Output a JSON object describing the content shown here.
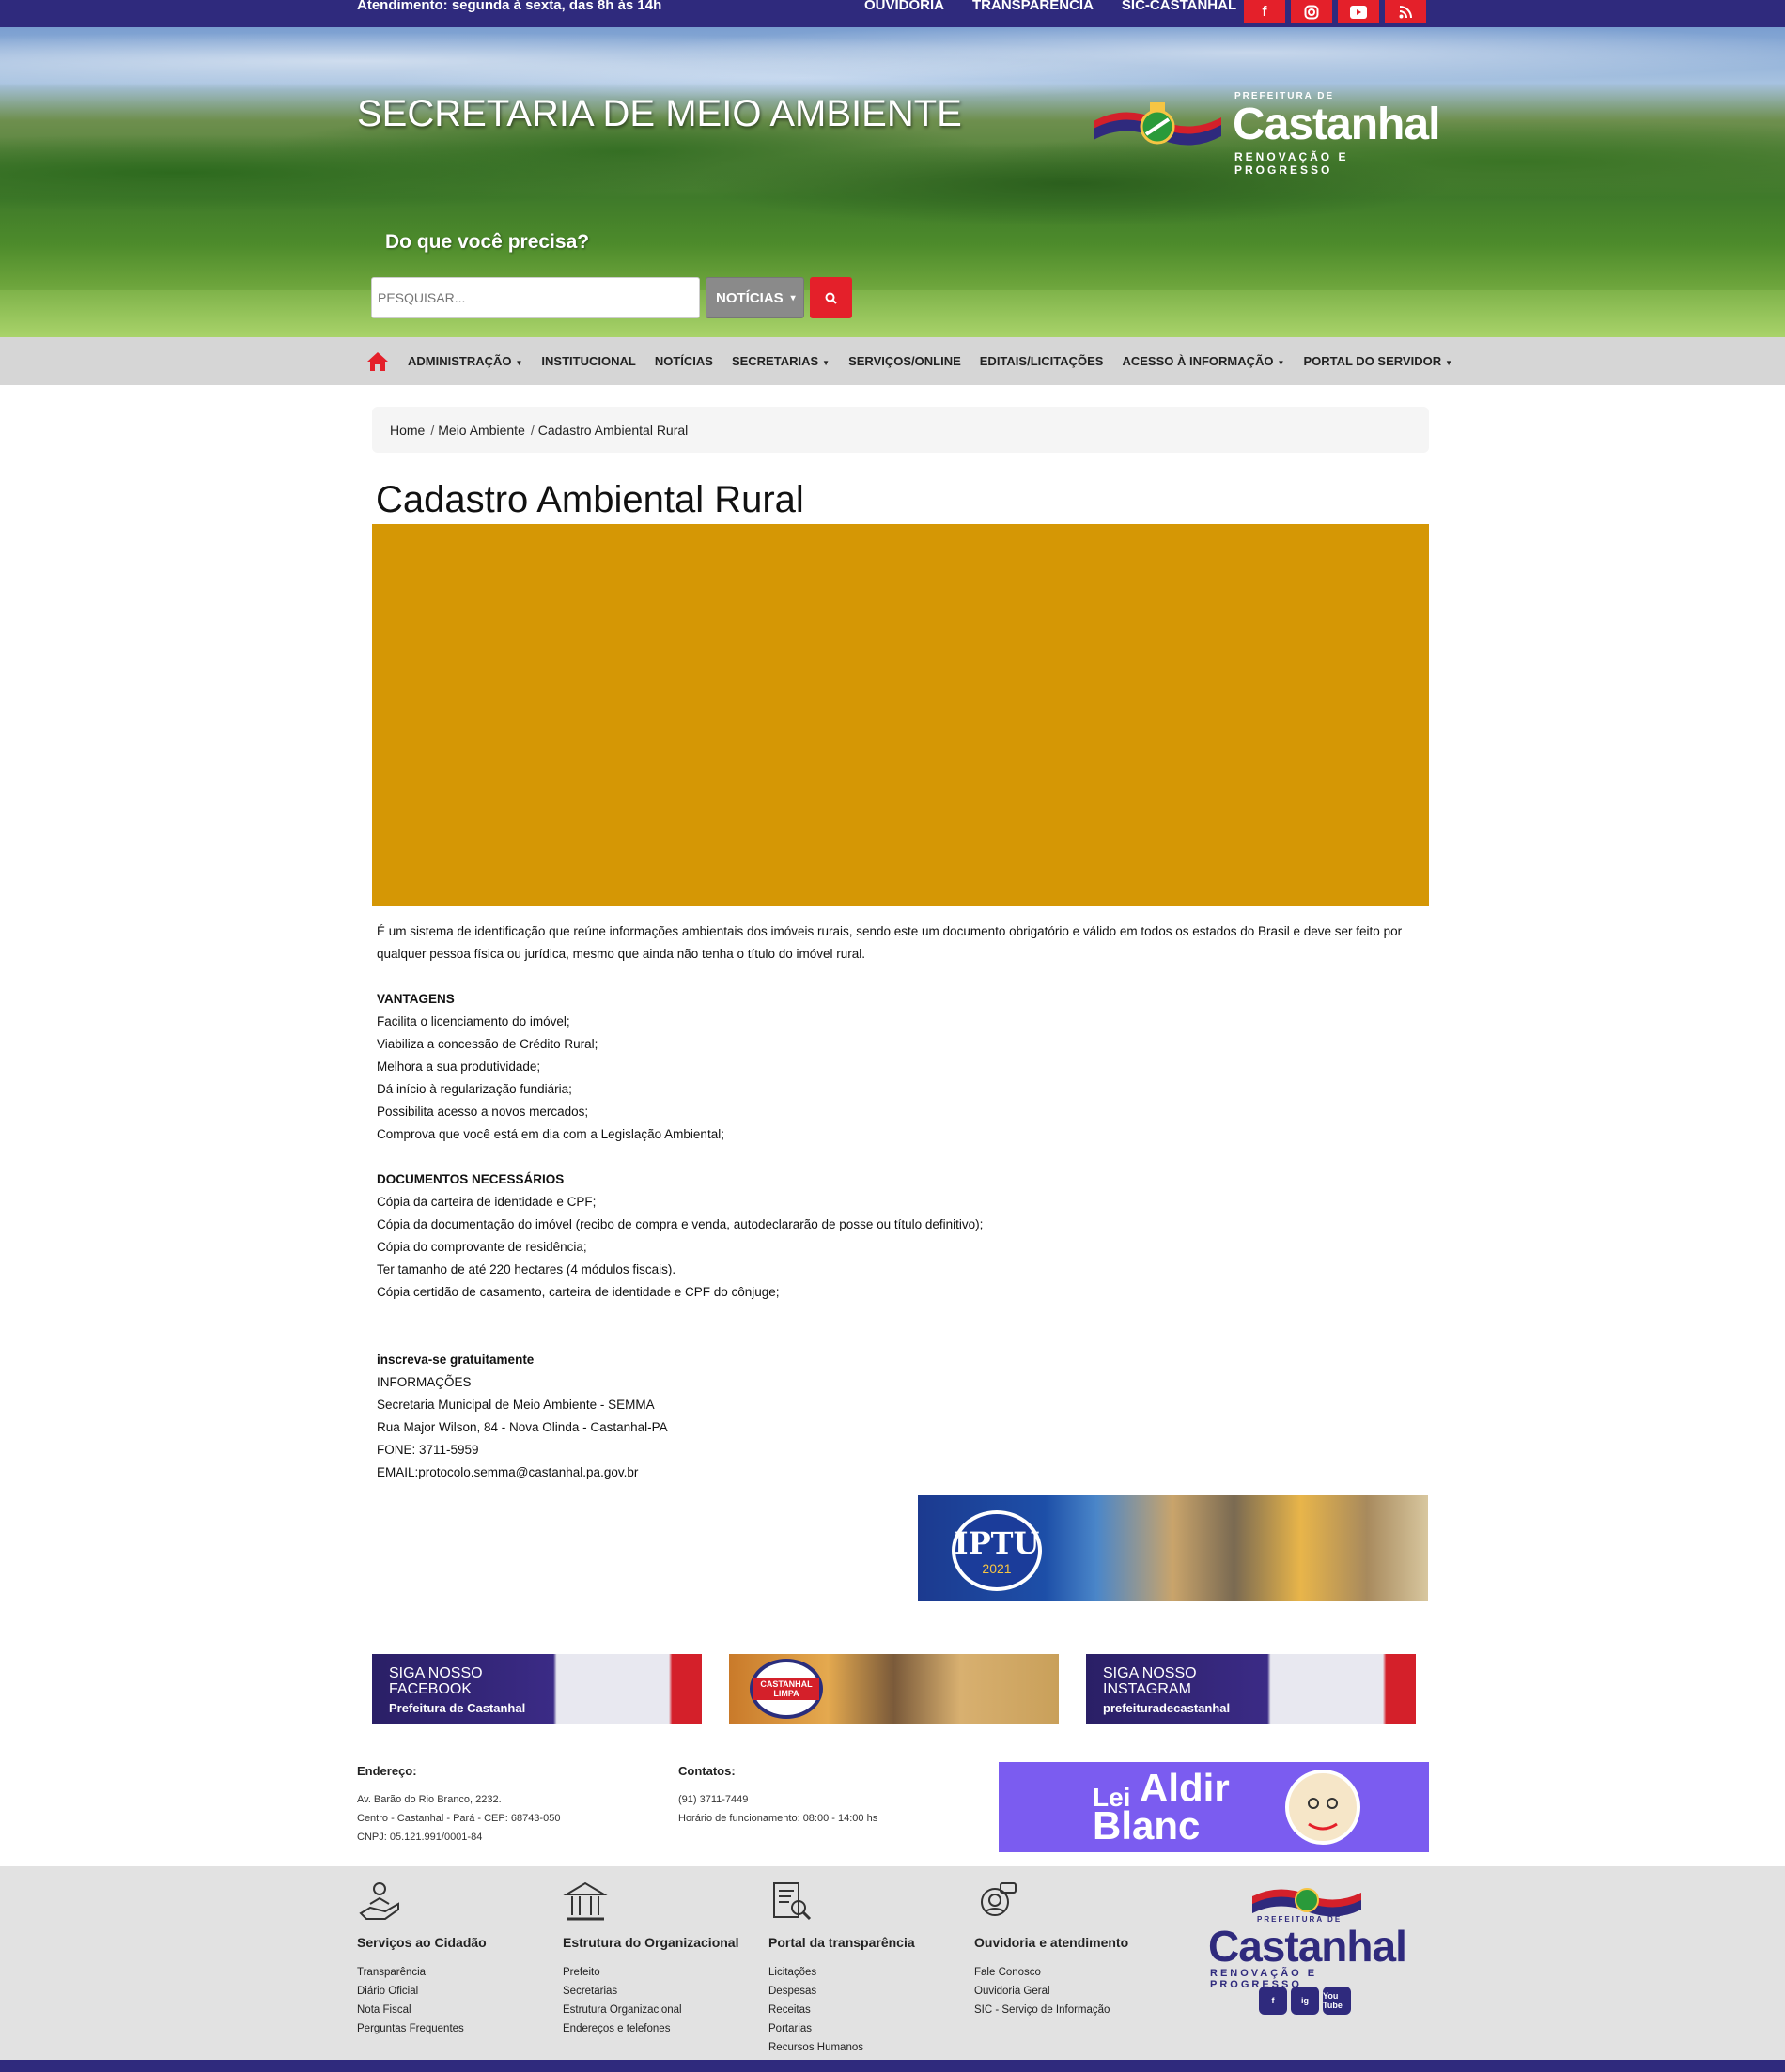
{
  "topbar": {
    "hours": "Atendimento: segunda à sexta, das 8h às 14h",
    "links": [
      "OUVIDORIA",
      "TRANSPARÊNCIA",
      "SIC-CASTANHAL"
    ],
    "social_icons": [
      "facebook-icon",
      "instagram-icon",
      "youtube-icon",
      "rss-icon"
    ],
    "accent": "#e4202a",
    "bg": "#2f2a7d"
  },
  "header": {
    "title": "SECRETARIA DE MEIO AMBIENTE",
    "logo": {
      "prefix": "PREFEITURA DE",
      "name": "Castanhal",
      "slogan": "RENOVAÇÃO E PROGRESSO"
    },
    "search_question": "Do que você precisa?",
    "search_placeholder": "PESQUISAR...",
    "search_category": "NOTÍCIAS"
  },
  "nav": {
    "items": [
      {
        "label": "ADMINISTRAÇÃO",
        "dropdown": true
      },
      {
        "label": "INSTITUCIONAL",
        "dropdown": false
      },
      {
        "label": "NOTÍCIAS",
        "dropdown": false
      },
      {
        "label": "SECRETARIAS",
        "dropdown": true
      },
      {
        "label": "SERVIÇOS/ONLINE",
        "dropdown": false
      },
      {
        "label": "EDITAIS/LICITAÇÕES",
        "dropdown": false
      },
      {
        "label": "ACESSO À INFORMAÇÃO",
        "dropdown": true
      },
      {
        "label": "PORTAL DO SERVIDOR",
        "dropdown": true
      }
    ]
  },
  "breadcrumb": {
    "home": "Home",
    "section": "Meio Ambiente",
    "current": "Cadastro Ambiental Rural"
  },
  "page": {
    "title": "Cadastro Ambiental Rural",
    "intro": "É um sistema de identificação que reúne informações ambientais dos imóveis rurais, sendo este um documento obrigatório e válido em todos os estados do Brasil e deve ser feito por qualquer pessoa física ou jurídica, mesmo que ainda não tenha o título do imóvel rural.",
    "vantagens_title": "VANTAGENS",
    "vantagens": [
      "Facilita o licenciamento do imóvel;",
      "Viabiliza a concessão de Crédito Rural;",
      "Melhora a sua produtividade;",
      "Dá início à regularização fundiária;",
      "Possibilita acesso a novos mercados;",
      "Comprova que você está em dia com a Legislação Ambiental;"
    ],
    "documentos_title": "DOCUMENTOS NECESSÁRIOS",
    "documentos": [
      "Cópia da carteira de identidade e CPF;",
      "Cópia da documentação do imóvel (recibo de compra e venda, autodeclararão de posse ou título definitivo);",
      "Cópia do comprovante de residência;",
      "Ter tamanho de até 220 hectares (4 módulos fiscais).",
      "Cópia certidão de casamento, carteira de identidade e CPF do cônjuge;"
    ],
    "inscreva": "inscreva-se gratuitamente",
    "info": [
      "INFORMAÇÕES",
      "Secretaria Municipal de Meio Ambiente - SEMMA",
      "Rua Major Wilson, 84 - Nova Olinda - Castanhal-PA",
      "FONE: 3711-5959",
      "EMAIL:protocolo.semma@castanhal.pa.gov.br"
    ],
    "image_color": "#d59705"
  },
  "iptu_banner": {
    "title": "IPTU",
    "year": "2021"
  },
  "banners": {
    "facebook": {
      "line1": "SIGA NOSSO",
      "line2": "FACEBOOK",
      "account": "Prefeitura de Castanhal"
    },
    "limpa": {
      "label": "CASTANHAL LIMPA"
    },
    "instagram": {
      "line1": "SIGA NOSSO",
      "line2": "INSTAGRAM",
      "account": "prefeiturадecastanhal"
    }
  },
  "footer_info": {
    "address_title": "Endereço:",
    "address": [
      "Av. Barão do Rio Branco, 2232.",
      "Centro - Castanhal - Pará - CEP: 68743-050",
      "CNPJ: 05.121.991/0001-84"
    ],
    "contacts_title": "Contatos:",
    "contacts": [
      "(91) 3711-7449",
      "Horário de funcionamento: 08:00 - 14:00 hs"
    ],
    "aldir": {
      "lei": "Lei",
      "aldir": "Aldir",
      "blanc": "Blanc"
    }
  },
  "footer": {
    "columns": [
      {
        "title": "Serviços ao Cidadão",
        "icon": "hand-person-icon",
        "links": [
          "Transparência",
          "Diário Oficial",
          "Nota Fiscal",
          "Perguntas Frequentes"
        ]
      },
      {
        "title": "Estrutura do Organizacional",
        "icon": "building-icon",
        "links": [
          "Prefeito",
          "Secretarias",
          "Estrutura Organizacional",
          "Endereços e telefones"
        ]
      },
      {
        "title": "Portal da transparência",
        "icon": "document-search-icon",
        "links": [
          "Licitações",
          "Despesas",
          "Receitas",
          "Portarias",
          "Recursos Humanos"
        ]
      },
      {
        "title": "Ouvidoria e atendimento",
        "icon": "support-agent-icon",
        "links": [
          "Fale Conosco",
          "Ouvidoria Geral",
          "SIC - Serviço de Informação"
        ]
      }
    ],
    "logo": {
      "prefix": "PREFEITURA DE",
      "name": "Castanhal",
      "slogan": "RENOVAÇÃO E PROGRESSO",
      "socials": [
        "f",
        "ig",
        "You Tube"
      ]
    }
  }
}
